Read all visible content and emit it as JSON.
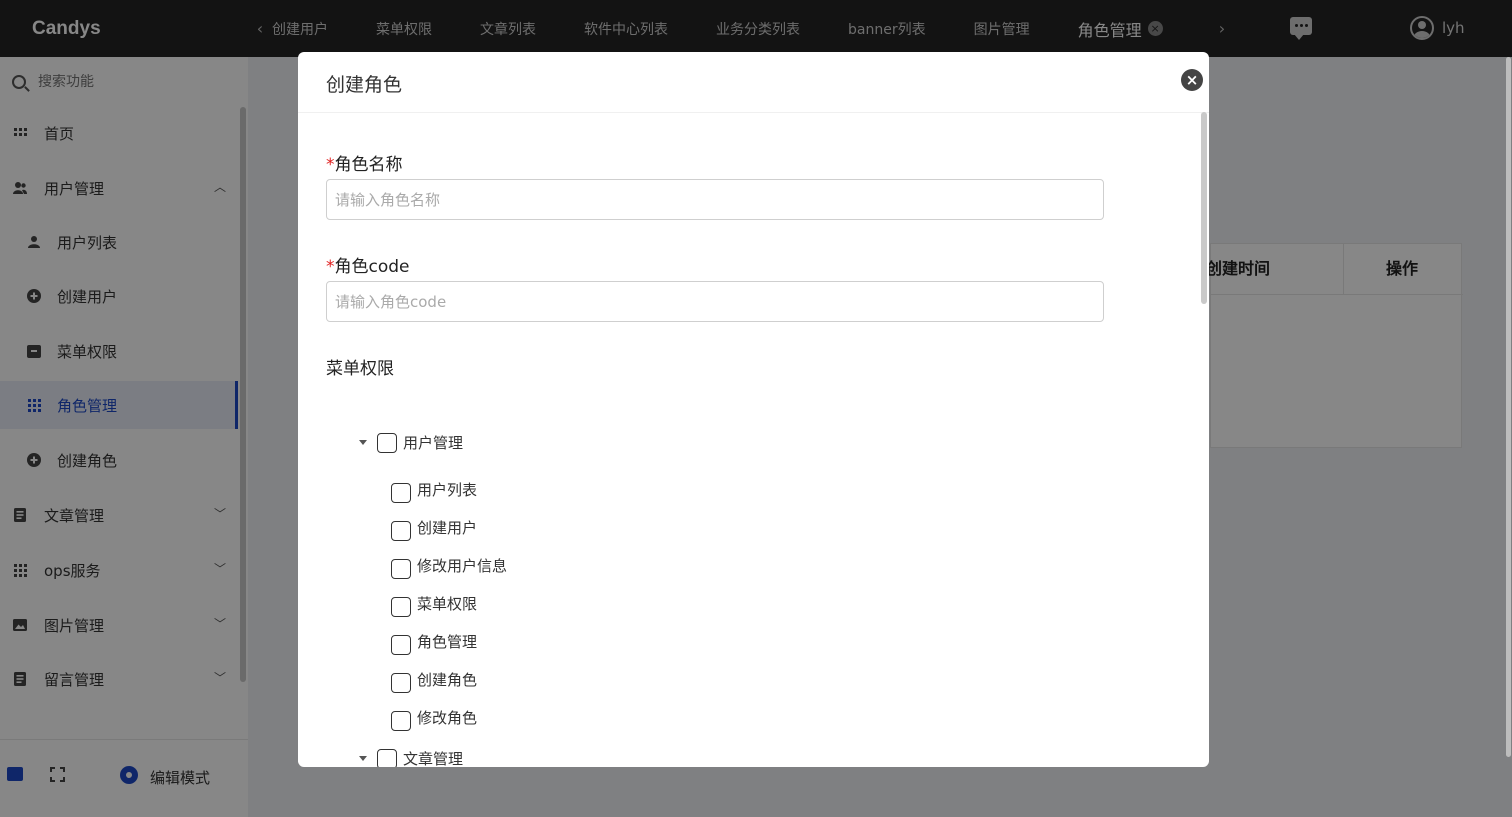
{
  "app": {
    "logo": "Candys",
    "username": "lyh"
  },
  "tabs": [
    {
      "label": "创建用户"
    },
    {
      "label": "菜单权限"
    },
    {
      "label": "文章列表"
    },
    {
      "label": "软件中心列表"
    },
    {
      "label": "业务分类列表"
    },
    {
      "label": "banner列表"
    },
    {
      "label": "图片管理"
    },
    {
      "label": "角色管理"
    }
  ],
  "sidebar": {
    "search_placeholder": "搜索功能",
    "items": [
      {
        "label": "首页"
      },
      {
        "label": "用户管理"
      },
      {
        "label": "用户列表"
      },
      {
        "label": "创建用户"
      },
      {
        "label": "菜单权限"
      },
      {
        "label": "角色管理"
      },
      {
        "label": "创建角色"
      },
      {
        "label": "文章管理"
      },
      {
        "label": "ops服务"
      },
      {
        "label": "图片管理"
      },
      {
        "label": "留言管理"
      }
    ],
    "footer": {
      "edit_mode": "编辑模式"
    }
  },
  "table": {
    "col_time": "创建时间",
    "col_op": "操作"
  },
  "modal": {
    "title": "创建角色",
    "required_mark": "*",
    "role_name": {
      "label": "角色名称",
      "placeholder": "请输入角色名称"
    },
    "role_code": {
      "label": "角色code",
      "placeholder": "请输入角色code"
    },
    "menu_perm_label": "菜单权限",
    "tree": {
      "user_mgmt": "用户管理",
      "children": [
        "用户列表",
        "创建用户",
        "修改用户信息",
        "菜单权限",
        "角色管理",
        "创建角色",
        "修改角色"
      ],
      "article_mgmt": "文章管理"
    }
  }
}
